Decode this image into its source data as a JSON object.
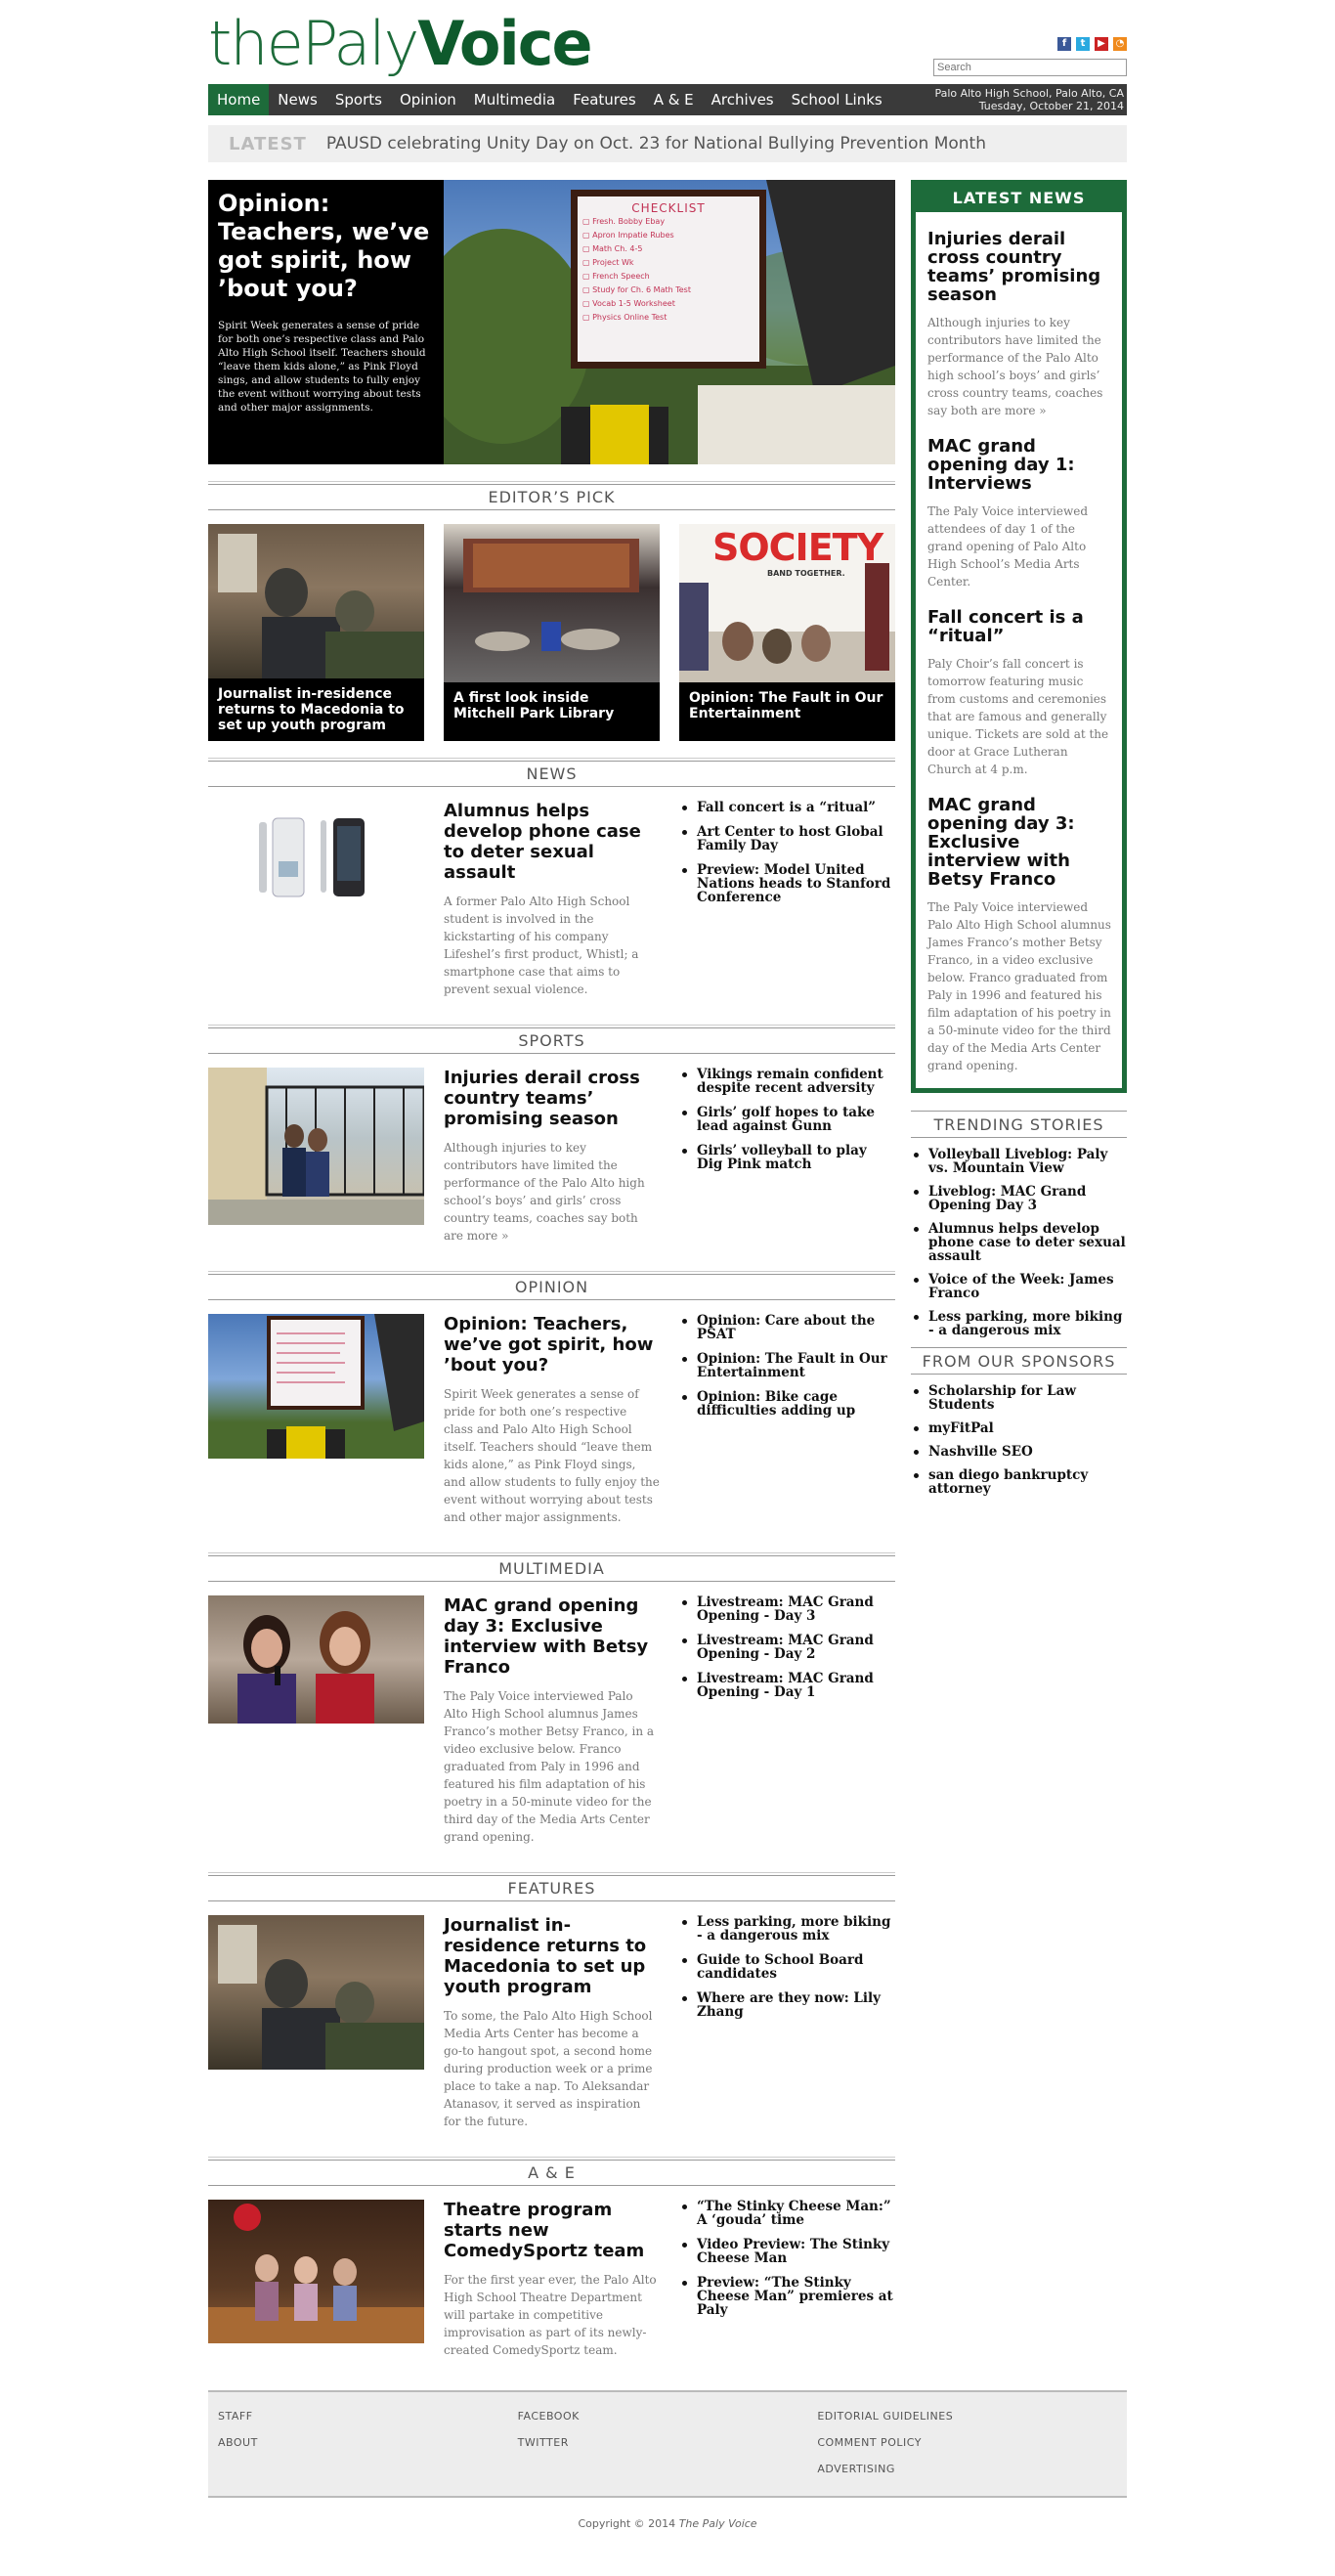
{
  "header": {
    "logo_part1": "thePaly",
    "logo_part2": "Voice",
    "search_placeholder": "Search",
    "social_icons": [
      "facebook-icon",
      "twitter-icon",
      "youtube-icon",
      "rss-icon"
    ],
    "location": "Palo Alto High School, Palo Alto, CA",
    "date": "Tuesday, October 21, 2014"
  },
  "nav": {
    "items": [
      "Home",
      "News",
      "Sports",
      "Opinion",
      "Multimedia",
      "Features",
      "A & E",
      "Archives",
      "School Links"
    ]
  },
  "latest_bar": {
    "label": "LATEST",
    "text": "PAUSD celebrating Unity Day on Oct. 23 for National Bullying Prevention Month"
  },
  "hero": {
    "title": "Opinion: Teachers, we’ve got spirit, how ’bout you?",
    "summary": "Spirit Week generates a sense of pride for both one’s respective class and Palo Alto High School itself. Teachers should “leave them kids alone,” as Pink Floyd sings, and allow students to fully enjoy the event without worrying about tests and other major assignments.",
    "board_title": "CHECKLIST",
    "board_items": [
      "Fresh. Bobby Ebay",
      "Apron Impatie Rubes",
      "Math Ch. 4-5",
      "Project Wk",
      "French Speech",
      "Study for Ch. 6 Math Test",
      "Vocab 1-5 Worksheet",
      "Physics Online Test"
    ]
  },
  "editors_pick": {
    "heading": "EDITOR’S PICK",
    "items": [
      {
        "caption": "Journalist in-residence returns to Macedonia to set up youth program"
      },
      {
        "caption": "A first look inside Mitchell Park Library"
      },
      {
        "caption": "Opinion: The Fault in Our Entertainment"
      }
    ],
    "poster_title": "SOCIETY",
    "poster_tag": "BAND TOGETHER."
  },
  "sections": [
    {
      "heading": "NEWS",
      "title": "Alumnus helps develop phone case to deter sexual assault",
      "summary": "A former Palo Alto High School student is involved in the kickstarting of his company Lifeshel’s first product, Whistl; a smartphone case that aims to prevent sexual violence.",
      "list": [
        "Fall concert is a “ritual”",
        "Art Center to host Global Family Day",
        "Preview: Model United Nations heads to Stanford Conference"
      ]
    },
    {
      "heading": "SPORTS",
      "title": "Injuries derail cross country teams’ promising season",
      "summary": "Although injuries to key contributors have limited the performance of the Palo Alto high school’s boys’ and girls’ cross country teams, coaches say both are more »",
      "list": [
        "Vikings remain confident despite recent adversity",
        "Girls’ golf hopes to take lead against Gunn",
        "Girls’ volleyball to play Dig Pink match"
      ]
    },
    {
      "heading": "OPINION",
      "title": "Opinion: Teachers, we’ve got spirit, how ’bout you?",
      "summary": "Spirit Week generates a sense of pride for both one’s respective class and Palo Alto High School itself. Teachers should “leave them kids alone,” as Pink Floyd sings, and allow students to fully enjoy the event without worrying about tests and other major assignments.",
      "list": [
        "Opinion: Care about the PSAT",
        "Opinion: The Fault in Our Entertainment",
        "Opinion: Bike cage difficulties adding up"
      ]
    },
    {
      "heading": "MULTIMEDIA",
      "title": "MAC grand opening day 3: Exclusive interview with Betsy Franco",
      "summary": "The Paly Voice interviewed Palo Alto High School alumnus James Franco’s mother Betsy Franco, in a video exclusive below. Franco graduated from Paly in 1996 and featured his film adaptation of his poetry in a 50-minute video for the third day of the Media Arts Center grand opening.",
      "list": [
        "Livestream: MAC Grand Opening - Day 3",
        "Livestream: MAC Grand Opening - Day 2",
        "Livestream: MAC Grand Opening - Day 1"
      ]
    },
    {
      "heading": "FEATURES",
      "title": "Journalist in-residence returns to Macedonia to set up youth program",
      "summary": "To some, the Palo Alto High School Media Arts Center has become a go-to hangout spot, a second home during production week or a prime place to take a nap. To Aleksandar Atanasov, it served as inspiration for the future.",
      "list": [
        "Less parking, more biking - a dangerous mix",
        "Guide to School Board candidates",
        "Where are they now: Lily Zhang"
      ]
    },
    {
      "heading": "A & E",
      "title": "Theatre program starts new ComedySportz team",
      "summary": "For the first year ever, the Palo Alto High School Theatre Department will partake in competitive improvisation as part of its newly-created ComedySportz team.",
      "list": [
        "“The Stinky Cheese Man:” A ‘gouda’ time",
        "Video Preview: The Stinky Cheese Man",
        "Preview: “The Stinky Cheese Man” premieres at Paly"
      ]
    }
  ],
  "latest_news": {
    "heading": "LATEST NEWS",
    "items": [
      {
        "title": "Injuries derail cross country teams’ promising season",
        "summary": "Although injuries to key contributors have limited the performance of the Palo Alto high school’s boys’ and girls’ cross country teams, coaches say both are more »"
      },
      {
        "title": "MAC grand opening day 1: Interviews",
        "summary": "The Paly Voice interviewed attendees of day 1 of the grand opening of Palo Alto High School’s Media Arts Center."
      },
      {
        "title": "Fall concert is a “ritual”",
        "summary": "Paly Choir’s fall concert is tomorrow featuring music from customs and ceremonies that are famous and generally unique. Tickets are sold at the door at Grace Lutheran Church at 4 p.m."
      },
      {
        "title": "MAC grand opening day 3: Exclusive interview with Betsy Franco",
        "summary": "The Paly Voice interviewed Palo Alto High School alumnus James Franco’s mother Betsy Franco, in a video exclusive below. Franco graduated from Paly in 1996 and featured his film adaptation of his poetry in a 50-minute video for the third day of the Media Arts Center grand opening."
      }
    ]
  },
  "trending": {
    "heading": "TRENDING STORIES",
    "items": [
      "Volleyball Liveblog: Paly vs. Mountain View",
      "Liveblog: MAC Grand Opening Day 3",
      "Alumnus helps develop phone case to deter sexual assault",
      "Voice of the Week: James Franco",
      "Less parking, more biking - a dangerous mix"
    ]
  },
  "sponsors": {
    "heading": "FROM OUR SPONSORS",
    "items": [
      "Scholarship for Law Students",
      "myFitPal",
      "Nashville SEO",
      "san diego bankruptcy attorney"
    ]
  },
  "footer": {
    "col1": [
      "STAFF",
      "ABOUT"
    ],
    "col2": [
      "FACEBOOK",
      "TWITTER"
    ],
    "col3": [
      "EDITORIAL GUIDELINES",
      "COMMENT POLICY",
      "ADVERTISING"
    ],
    "copyright_prefix": "Copyright © 2014",
    "copyright_name": "The Paly Voice"
  },
  "colors": {
    "brand_green": "#1d6b3a",
    "nav_bg": "#3a3a3a"
  }
}
